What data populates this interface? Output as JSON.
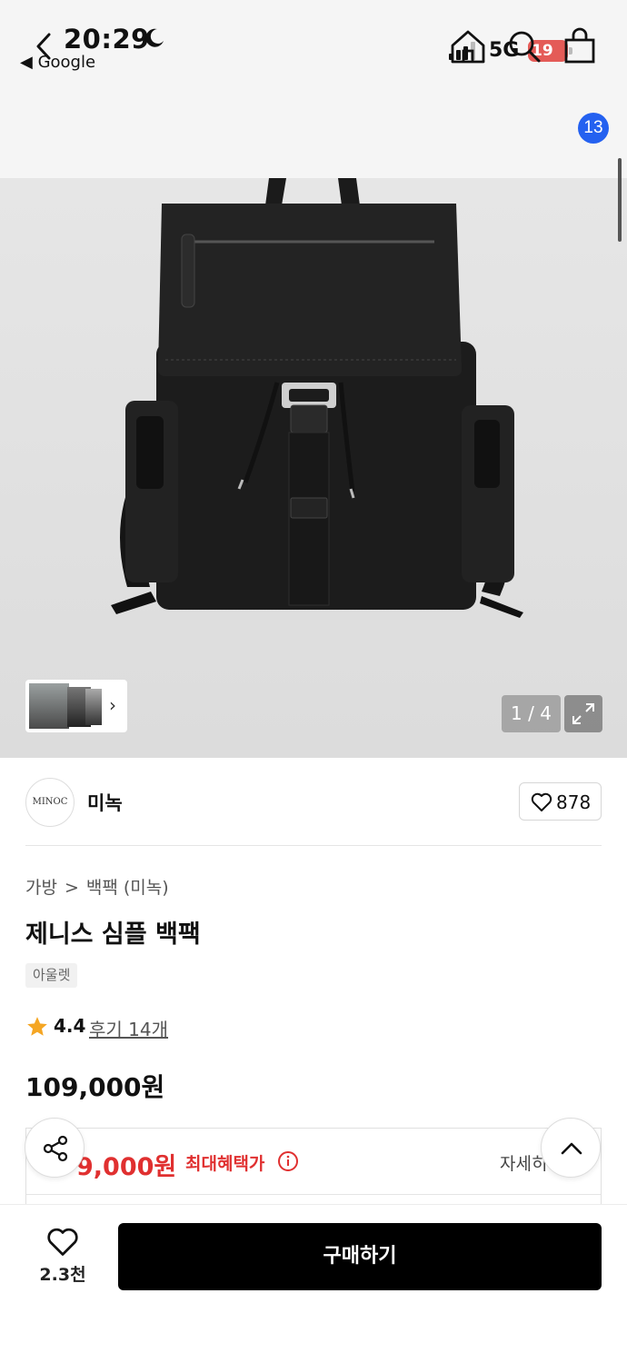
{
  "status_bar": {
    "time": "20:29",
    "back_app": "◀ Google",
    "network": "5G",
    "battery": "19"
  },
  "nav": {
    "cart_count": "13"
  },
  "gallery": {
    "pager": "1 / 4"
  },
  "brand": {
    "logo_text": "MINOC",
    "name": "미녹",
    "like_count": "878"
  },
  "product": {
    "breadcrumb": [
      "가방",
      ">",
      "백팩 (미녹)"
    ],
    "title": "제니스 심플 백팩",
    "tag": "아울렛",
    "rating": "4.4",
    "reviews": "후기 14개",
    "price": "109,000원"
  },
  "benefit": {
    "price": "9,000원",
    "label": "최대혜택가",
    "detail": "자세히"
  },
  "bottom": {
    "wish_count": "2.3천",
    "buy_label": "구매하기"
  },
  "colors": {
    "accent_badge": "#2461f0",
    "benefit_red": "#e03030",
    "battery_low": "#e45b57",
    "star": "#f5a623"
  }
}
